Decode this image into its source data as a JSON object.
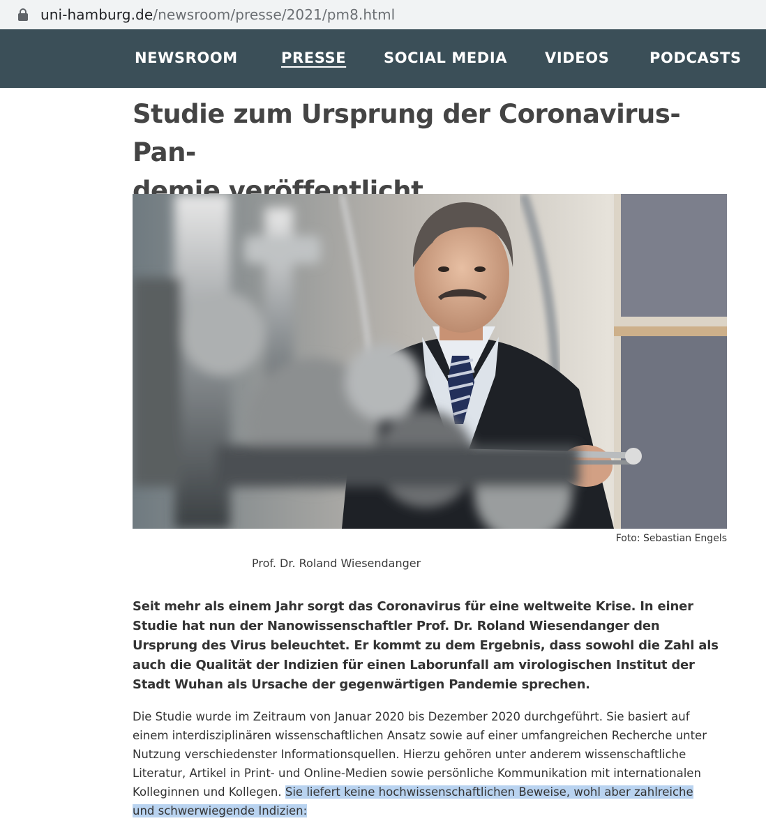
{
  "browser": {
    "url_host": "uni-hamburg.de",
    "url_path": "/newsroom/presse/2021/pm8.html"
  },
  "nav": {
    "items": [
      {
        "label": "NEWSROOM",
        "active": false
      },
      {
        "label": "PRESSE",
        "active": true
      },
      {
        "label": "SOCIAL MEDIA",
        "active": false
      },
      {
        "label": "VIDEOS",
        "active": false
      },
      {
        "label": "PODCASTS",
        "active": false
      }
    ]
  },
  "article": {
    "headline_line1": "Studie zum Ursprung der Coronavirus-Pan-",
    "headline_line2": "demie veröffentlicht",
    "photo_credit": "Foto: Sebastian Engels",
    "photo_caption": "Prof. Dr. Roland Wiesendanger",
    "lead": "Seit mehr als einem Jahr sorgt das Coronavirus für eine weltweite Krise. In einer Studie hat nun der Nanowissenschaftler Prof. Dr. Roland Wiesendanger den Ursprung des Virus beleuchtet. Er kommt zu dem Ergebnis, dass sowohl die Zahl als auch die Qualität der Indizien für einen Laborunfall am virologischen Institut der Stadt Wuhan als Ursache der gegenwärtigen Pandemie sprechen.",
    "body_plain": "Die Studie wurde im Zeitraum von Januar 2020 bis Dezember 2020 durchgeführt. Sie basiert auf einem interdisziplinären wissenschaftlichen Ansatz sowie auf einer umfangreichen Recherche unter Nutzung verschiedenster Informationsquellen. Hierzu gehören unter anderem wissenschaftliche Literatur, Artikel in Print- und Online-Medien sowie persönliche Kommunikation mit internationalen Kolleginnen und Kollegen. ",
    "body_highlighted": "Sie liefert keine hochwissenschaftlichen Beweise, wohl aber zahlreiche und schwerwiegende Indizien:"
  },
  "colors": {
    "nav_bg": "#3b4f58",
    "highlight": "#b9d3f0"
  }
}
